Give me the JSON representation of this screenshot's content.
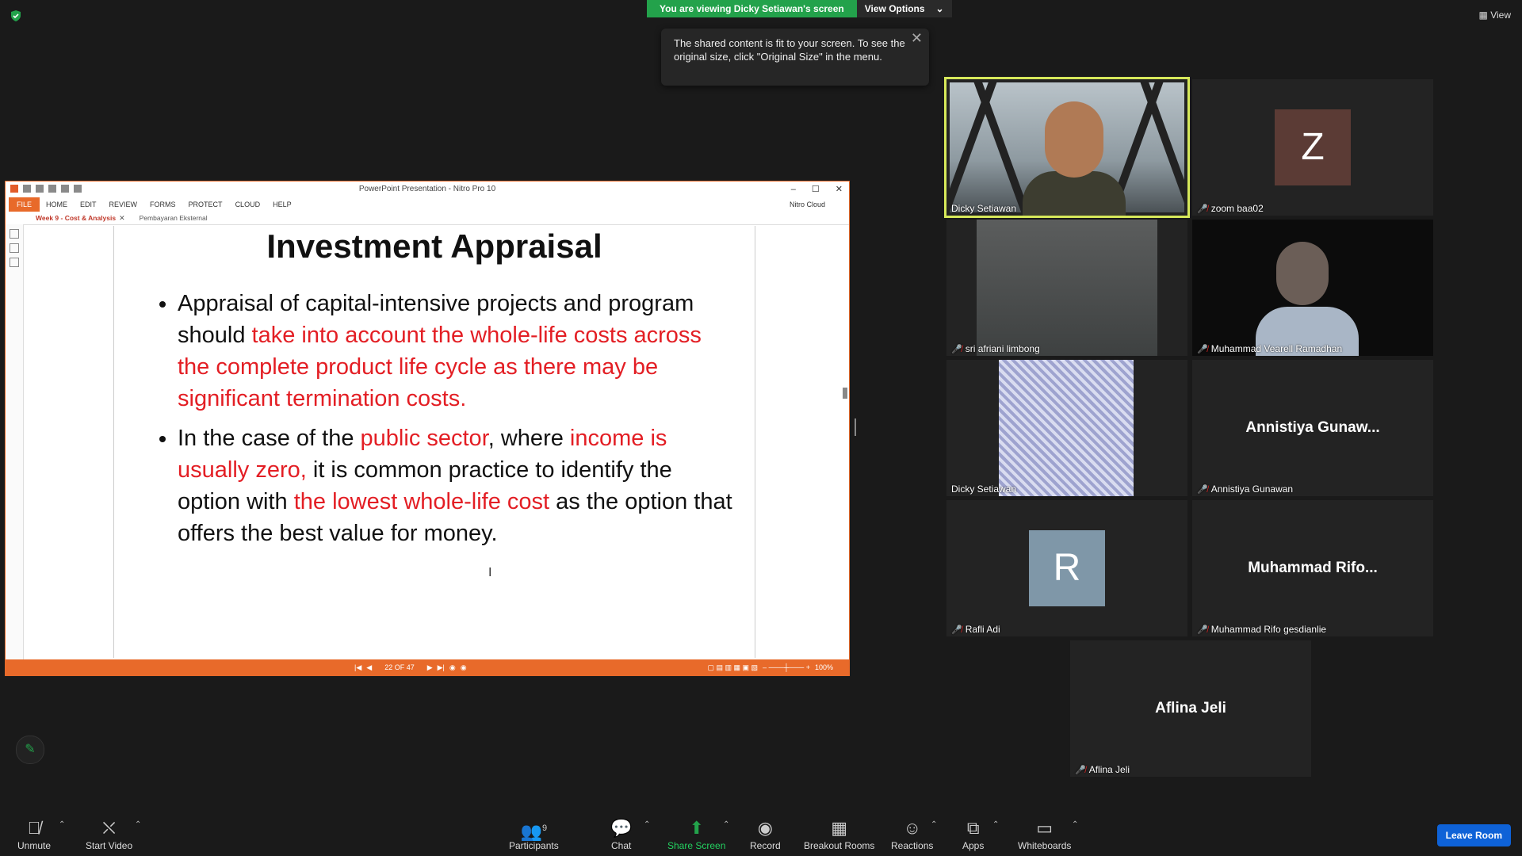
{
  "banner": {
    "viewing": "You are viewing Dicky Setiawan's screen",
    "view_options": "View Options"
  },
  "tooltip": {
    "text": "The shared content is fit to your screen. To see the original size, click \"Original Size\" in the menu."
  },
  "view_button": "View",
  "ppt": {
    "title": "PowerPoint Presentation - Nitro Pro 10",
    "ribbon": [
      "FILE",
      "HOME",
      "EDIT",
      "REVIEW",
      "FORMS",
      "PROTECT",
      "CLOUD",
      "HELP"
    ],
    "cloud_user": "Nitro Cloud",
    "tabs": [
      "Week 9 - Cost & Analysis",
      "Pembayaran Eksternal"
    ],
    "page": "22 OF 47",
    "zoom": "100%",
    "slide": {
      "title": "Investment Appraisal",
      "b1_p1": "Appraisal of capital-intensive projects and program should ",
      "b1_red": "take into account the whole-life costs across the complete product life cycle as there may be significant termination costs.",
      "b2_p1": "In the case of the ",
      "b2_red1": "public sector",
      "b2_p2": ", where ",
      "b2_red2": "income is usually zero,",
      "b2_p3": " it is common practice to identify the option with ",
      "b2_red3": "the lowest whole-life cost",
      "b2_p4": " as the option that offers the best value for money."
    }
  },
  "participants": [
    {
      "name": "Dicky Setiawan"
    },
    {
      "name": "zoom baa02",
      "avatar": "Z",
      "avatar_color": "#5b3b35"
    },
    {
      "name": "sri afriani limbong"
    },
    {
      "name": "Muhammad Vearell Ramadhan"
    },
    {
      "name": "Dicky Setiawan"
    },
    {
      "name": "Annistiya Gunawan",
      "display": "Annistiya  Gunaw..."
    },
    {
      "name": "Rafli Adi",
      "avatar": "R",
      "avatar_color": "#7f97a8"
    },
    {
      "name": "Muhammad Rifo gesdianlie",
      "display": "Muhammad  Rifo..."
    },
    {
      "name": "Aflina Jeli",
      "display": "Aflina Jeli"
    }
  ],
  "toolbar": {
    "unmute": "Unmute",
    "start_video": "Start Video",
    "participants": "Participants",
    "participants_count": "9",
    "chat": "Chat",
    "share_screen": "Share Screen",
    "record": "Record",
    "breakout": "Breakout Rooms",
    "reactions": "Reactions",
    "apps": "Apps",
    "whiteboards": "Whiteboards",
    "leave": "Leave Room"
  }
}
